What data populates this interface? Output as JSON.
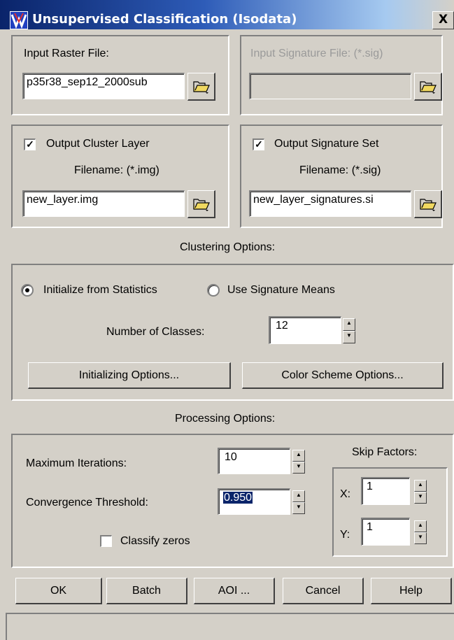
{
  "window": {
    "title": "Unsupervised Classification (Isodata)",
    "close_label": "X"
  },
  "input_raster": {
    "label": "Input Raster File:",
    "value": "p35r38_sep12_2000sub"
  },
  "input_signature": {
    "label": "Input Signature File: (*.sig)",
    "value": ""
  },
  "output_cluster": {
    "checkbox_label": "Output Cluster Layer",
    "checked": "✓",
    "filename_label": "Filename: (*.img)",
    "value": "new_layer.img"
  },
  "output_signature": {
    "checkbox_label": "Output Signature Set",
    "checked": "✓",
    "filename_label": "Filename: (*.sig)",
    "value": "new_layer_signatures.si"
  },
  "clustering": {
    "header": "Clustering Options:",
    "radio_stats_label": "Initialize from Statistics",
    "radio_means_label": "Use Signature Means",
    "num_classes_label": "Number of Classes:",
    "num_classes_value": "12",
    "init_options_button": "Initializing Options...",
    "color_scheme_button": "Color Scheme Options..."
  },
  "processing": {
    "header": "Processing Options:",
    "max_iter_label": "Maximum Iterations:",
    "max_iter_value": "10",
    "convergence_label": "Convergence Threshold:",
    "convergence_value": "0.950",
    "classify_zeros_label": "Classify zeros",
    "skip_factors_label": "Skip Factors:",
    "x_label": "X:",
    "x_value": "1",
    "y_label": "Y:",
    "y_value": "1"
  },
  "buttons": {
    "ok": "OK",
    "batch": "Batch",
    "aoi": "AOI ...",
    "cancel": "Cancel",
    "help": "Help"
  },
  "status_text": ""
}
